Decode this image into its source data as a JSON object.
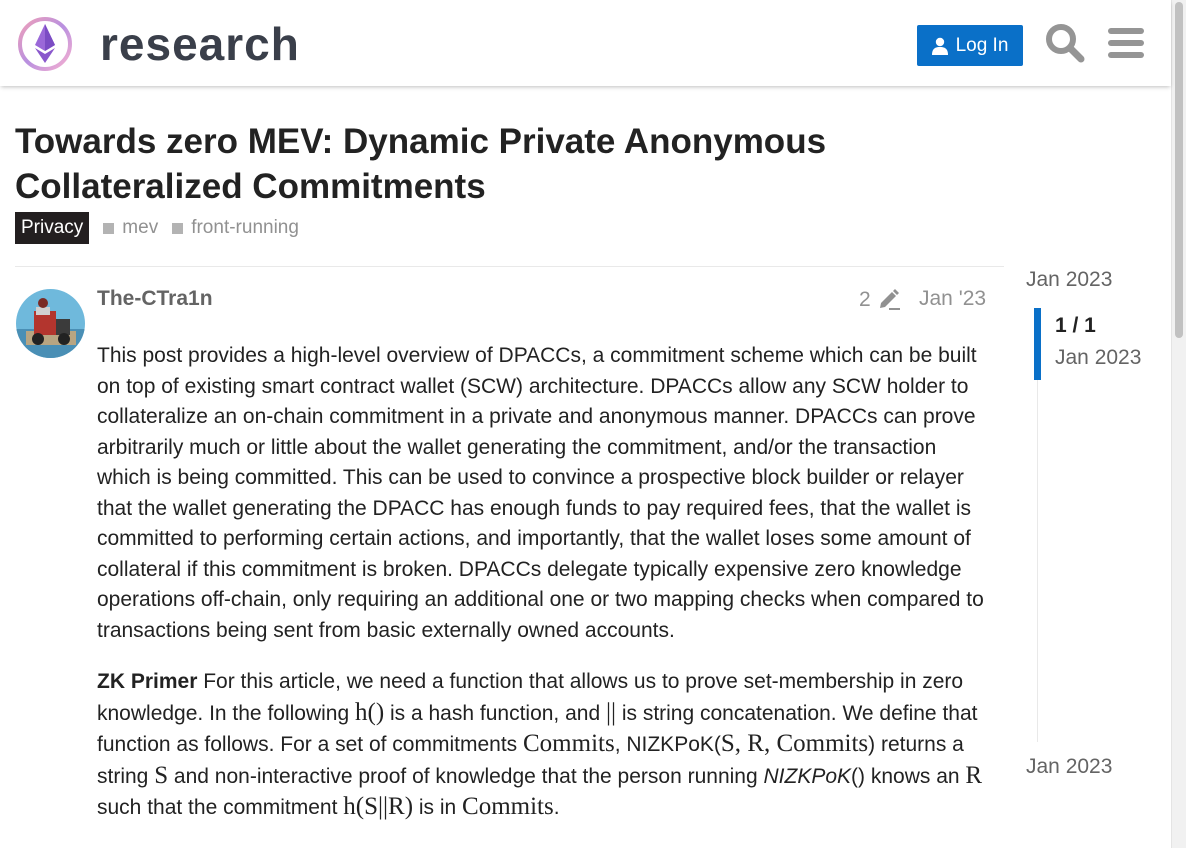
{
  "header": {
    "site_name": "research",
    "login_label": "Log In",
    "search_icon": "search-icon",
    "menu_icon": "hamburger-menu-icon",
    "accent_color": "#0a70c8"
  },
  "topic": {
    "title": "Towards zero MEV: Dynamic Private Anonymous Collateralized Commitments",
    "category": "Privacy",
    "tags": [
      "mev",
      "front-running"
    ]
  },
  "post": {
    "author": "The-CTra1n",
    "edit_count": "2",
    "date": "Jan '23",
    "paragraph1": "This post provides a high-level overview of DPACCs, a commitment scheme which can be built on top of existing smart contract wallet (SCW) architecture. DPACCs allow any SCW holder to collateralize an on-chain commitment in a private and anonymous manner. DPACCs can prove arbitrarily much or little about the wallet generating the commitment, and/or the transaction which is being committed. This can be used to convince a prospective block builder or relayer that the wallet generating the DPACC has enough funds to pay required fees, that the wallet is committed to performing certain actions, and importantly, that the wallet loses some amount of collateral if this commitment is broken. DPACCs delegate typically expensive zero knowledge operations off-chain, only requiring an additional one or two mapping checks when compared to transactions being sent from basic externally owned accounts.",
    "zk": {
      "heading": "ZK Primer",
      "t1": " For this article, we need a function that allows us to prove set-membership in zero knowledge. In the following ",
      "m1": "h()",
      "t2": " is a hash function, and ",
      "m2": "||",
      "t3": " is string concatenation. We define that function as follows. For a set of commitments ",
      "m3": "Commits",
      "t4": ", NIZKPoK(",
      "m4": "S, R, Commits",
      "t5": ") returns a string ",
      "m5": "S",
      "t6": " and non-interactive proof of knowledge that the person running ",
      "t7": "NIZKPoK",
      "t8": "() knows an ",
      "m6": "R",
      "t9": " such that the commitment ",
      "m7": "h(S||R)",
      "t10": " is in ",
      "m8": "Commits",
      "t11": "."
    }
  },
  "timeline": {
    "start": "Jan 2023",
    "position": "1 / 1",
    "current_date": "Jan 2023",
    "end": "Jan 2023"
  }
}
